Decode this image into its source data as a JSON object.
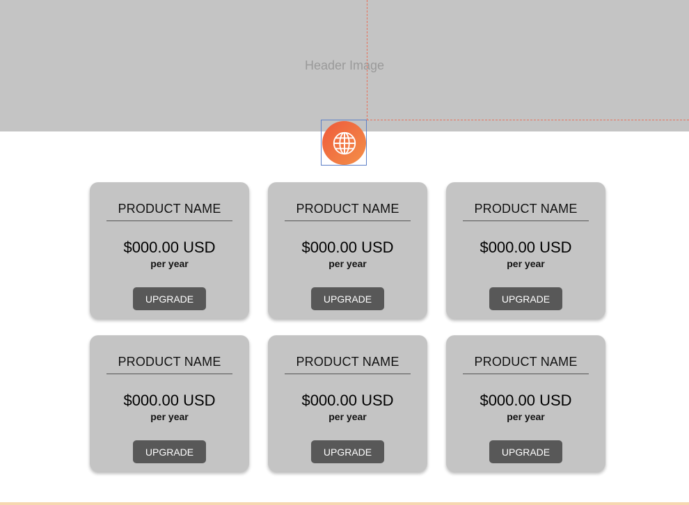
{
  "header": {
    "label": "Header Image",
    "icon": "globe-icon",
    "icon_gradient": [
      "#ee5a3c",
      "#f49048"
    ]
  },
  "colors": {
    "header_bg": "#c4c4c4",
    "card_bg": "#c4c4c4",
    "button_bg": "#585858",
    "guide": "#e8715a",
    "selection": "#5b7fc7"
  },
  "cards": [
    {
      "title": "PRODUCT NAME",
      "price": "$000.00 USD",
      "period": "per year",
      "button": "UPGRADE"
    },
    {
      "title": "PRODUCT NAME",
      "price": "$000.00 USD",
      "period": "per year",
      "button": "UPGRADE"
    },
    {
      "title": "PRODUCT NAME",
      "price": "$000.00 USD",
      "period": "per year",
      "button": "UPGRADE"
    },
    {
      "title": "PRODUCT NAME",
      "price": "$000.00 USD",
      "period": "per year",
      "button": "UPGRADE"
    },
    {
      "title": "PRODUCT NAME",
      "price": "$000.00 USD",
      "period": "per year",
      "button": "UPGRADE"
    },
    {
      "title": "PRODUCT NAME",
      "price": "$000.00 USD",
      "period": "per year",
      "button": "UPGRADE"
    }
  ]
}
